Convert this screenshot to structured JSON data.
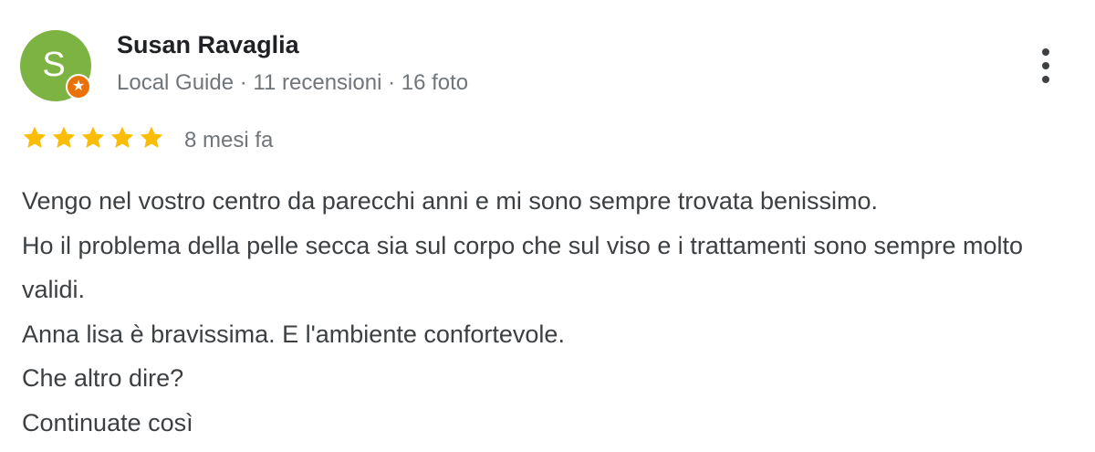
{
  "reviewer": {
    "initial": "S",
    "name": "Susan Ravaglia",
    "badge_icon": "local-guide-star-icon",
    "meta": {
      "role": "Local Guide",
      "separator": " · ",
      "reviews": "11 recensioni",
      "photos": "16 foto"
    }
  },
  "menu": {
    "icon": "more-vertical-icon"
  },
  "rating": {
    "stars": 5,
    "max_stars": 5,
    "time": "8 mesi fa"
  },
  "review": {
    "lines": [
      "Vengo nel vostro centro da parecchi anni e mi sono sempre trovata benissimo.",
      "Ho il problema della pelle secca sia sul corpo che sul viso e i trattamenti sono sempre molto validi.",
      "Anna lisa è bravissima. E l'ambiente confortevole.",
      "Che altro dire?",
      "Continuate così"
    ]
  },
  "colors": {
    "avatar": "#7cb342",
    "badge": "#e8710a",
    "star": "#fbbc04",
    "name": "#202124",
    "muted": "#70757a",
    "body": "#3c4043"
  }
}
